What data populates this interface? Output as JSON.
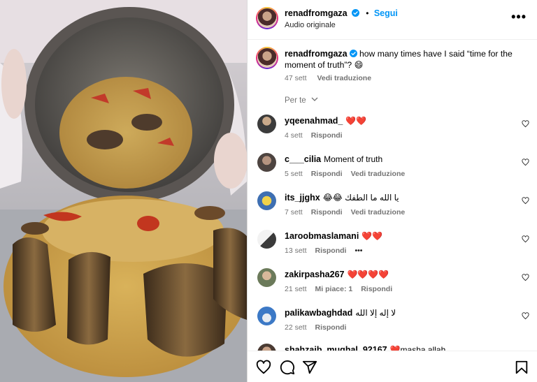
{
  "post": {
    "username": "renadfromgaza",
    "separator": "•",
    "follow_label": "Segui",
    "audio_label": "Audio originale",
    "more_label": "•••"
  },
  "caption": {
    "username": "renadfromgaza",
    "text": "how many times have I said “time for the moment of truth”? 😄",
    "age": "47 sett",
    "translate_label": "Vedi traduzione"
  },
  "sort": {
    "label": "Per te"
  },
  "comments": [
    {
      "username": "yqeenahmad_",
      "text": "❤️❤️",
      "age": "4 sett",
      "reply": "Rispondi",
      "translate": "",
      "likes": ""
    },
    {
      "username": "c___cilia",
      "text": "Moment of truth",
      "age": "5 sett",
      "reply": "Rispondi",
      "translate": "Vedi traduzione",
      "likes": ""
    },
    {
      "username": "its_jjghx",
      "text": "😂😂 يا الله ما الطفك",
      "age": "7 sett",
      "reply": "Rispondi",
      "translate": "Vedi traduzione",
      "likes": ""
    },
    {
      "username": "1aroobmaslamani",
      "text": "❤️❤️",
      "age": "13 sett",
      "reply": "Rispondi",
      "translate": "•••",
      "likes": ""
    },
    {
      "username": "zakirpasha267",
      "text": "❤️❤️❤️❤️",
      "age": "21 sett",
      "reply": "Rispondi",
      "translate": "",
      "likes": "Mi piace: 1"
    },
    {
      "username": "palikawbaghdad",
      "text": "لا إله إلا الله",
      "age": "22 sett",
      "reply": "Rispondi",
      "translate": "",
      "likes": ""
    },
    {
      "username": "shahzaib_mughal_92167",
      "text": "❤️masha allah",
      "age": "",
      "reply": "",
      "translate": "",
      "likes": ""
    }
  ],
  "icons": {
    "like": "heart-icon",
    "comment": "comment-icon",
    "share": "share-icon",
    "save": "bookmark-icon",
    "verified": "verified-badge-icon"
  },
  "colors": {
    "accent": "#0095f6",
    "verified": "#0095f6",
    "muted": "#737373"
  }
}
